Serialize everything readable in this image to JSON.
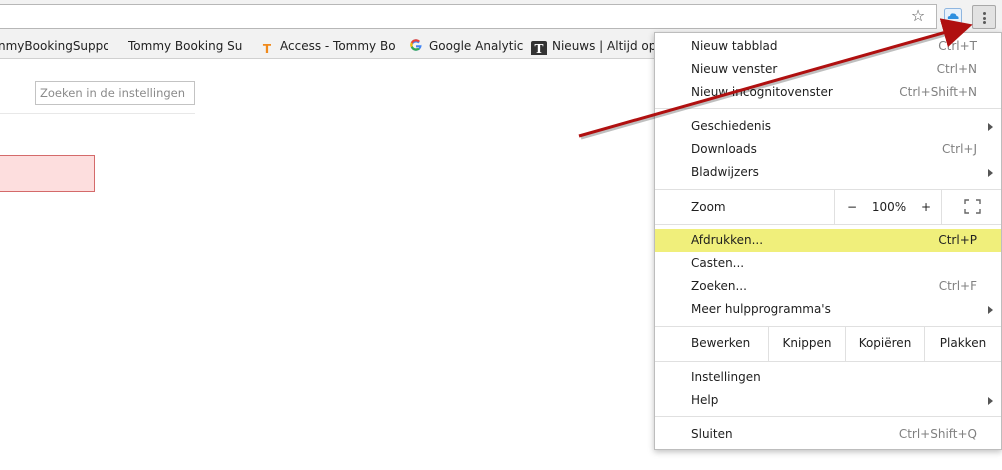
{
  "omnibox": {
    "star_icon": "star-icon",
    "extension_icon": "cloud-icon",
    "menu_icon": "three-dots-icon"
  },
  "bookmarks": [
    {
      "label": "nmyBookingSuppo",
      "icon": "none"
    },
    {
      "label": "Tommy Booking Supp",
      "icon": "none"
    },
    {
      "label": "Access - Tommy Book",
      "icon": "orange-t-icon"
    },
    {
      "label": "Google Analytics",
      "icon": "google-g-icon"
    },
    {
      "label": "Nieuws | Altijd op d",
      "icon": "newspaper-icon"
    }
  ],
  "settings": {
    "search_placeholder": "Zoeken in de instellingen"
  },
  "menu": {
    "group1": [
      {
        "label": "Nieuw tabblad",
        "shortcut": "Ctrl+T"
      },
      {
        "label": "Nieuw venster",
        "shortcut": "Ctrl+N"
      },
      {
        "label": "Nieuw incognitovenster",
        "shortcut": "Ctrl+Shift+N"
      }
    ],
    "group2": [
      {
        "label": "Geschiedenis",
        "shortcut": ""
      },
      {
        "label": "Downloads",
        "shortcut": "Ctrl+J"
      },
      {
        "label": "Bladwijzers",
        "shortcut": ""
      }
    ],
    "zoom": {
      "label": "Zoom",
      "minus": "−",
      "value": "100%",
      "plus": "+"
    },
    "group3": [
      {
        "label": "Afdrukken...",
        "shortcut": "Ctrl+P"
      },
      {
        "label": "Casten...",
        "shortcut": ""
      },
      {
        "label": "Zoeken...",
        "shortcut": "Ctrl+F"
      },
      {
        "label": "Meer hulpprogramma's",
        "shortcut": ""
      }
    ],
    "edit": {
      "label": "Bewerken",
      "cut": "Knippen",
      "copy": "Kopiëren",
      "paste": "Plakken"
    },
    "group4": [
      {
        "label": "Instellingen",
        "shortcut": ""
      },
      {
        "label": "Help",
        "shortcut": ""
      }
    ],
    "group5": [
      {
        "label": "Sluiten",
        "shortcut": "Ctrl+Shift+Q"
      }
    ]
  },
  "colors": {
    "highlight": "#f0ef7b",
    "annotation_arrow": "#b01010"
  }
}
